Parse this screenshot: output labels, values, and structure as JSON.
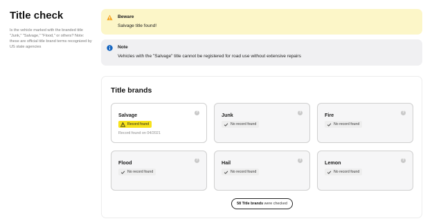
{
  "header": {
    "title": "Title check",
    "description": "Is the vehicle marked with the branded title \"Junk,\" \"Salvage,\" \"Flood,\" or others? Note: these are official title brand terms recognized by US state agencies"
  },
  "alerts": {
    "warning": {
      "title": "Beware",
      "text": "Salvage title found!",
      "icon": "warning-icon",
      "color": "#f5a623"
    },
    "info": {
      "title": "Note",
      "text": "Vehicles with the \"Salvage\" title cannot be registered for road use without extensive repairs",
      "icon": "info-icon",
      "color": "#1565c0"
    }
  },
  "brands": {
    "title": "Title brands",
    "cards": [
      {
        "name": "Salvage",
        "status": "Record found",
        "meta": "Record found on 04/2021"
      },
      {
        "name": "Junk",
        "status": "No record found"
      },
      {
        "name": "Fire",
        "status": "No record found"
      },
      {
        "name": "Flood",
        "status": "No record found"
      },
      {
        "name": "Hail",
        "status": "No record found"
      },
      {
        "name": "Lemon",
        "status": "No record found"
      }
    ],
    "checked_count": "58 Title brands",
    "checked_suffix": " were checked"
  },
  "colors": {
    "found_badge": "#f7e21c",
    "warning_bg": "#fcf6c8",
    "info_bg": "#f0f0f2"
  }
}
